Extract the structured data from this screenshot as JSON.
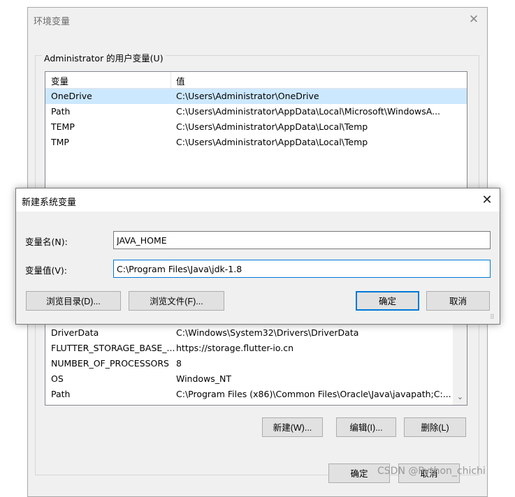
{
  "env_window": {
    "title": "环境变量",
    "user_group_label": "Administrator 的用户变量(U)",
    "user_list": {
      "col_name": "变量",
      "col_value": "值",
      "rows": [
        {
          "name": "OneDrive",
          "value": "C:\\Users\\Administrator\\OneDrive"
        },
        {
          "name": "Path",
          "value": "C:\\Users\\Administrator\\AppData\\Local\\Microsoft\\WindowsA..."
        },
        {
          "name": "TEMP",
          "value": "C:\\Users\\Administrator\\AppData\\Local\\Temp"
        },
        {
          "name": "TMP",
          "value": "C:\\Users\\Administrator\\AppData\\Local\\Temp"
        }
      ]
    },
    "sys_list": {
      "rows": [
        {
          "name": "DriverData",
          "value": "C:\\Windows\\System32\\Drivers\\DriverData"
        },
        {
          "name": "FLUTTER_STORAGE_BASE_...",
          "value": "https://storage.flutter-io.cn"
        },
        {
          "name": "NUMBER_OF_PROCESSORS",
          "value": "8"
        },
        {
          "name": "OS",
          "value": "Windows_NT"
        },
        {
          "name": "Path",
          "value": "C:\\Program Files (x86)\\Common Files\\Oracle\\Java\\javapath;C:..."
        }
      ]
    },
    "buttons": {
      "new": "新建(W)...",
      "edit": "编辑(I)...",
      "delete": "删除(L)",
      "ok": "确定",
      "cancel": "取消"
    }
  },
  "dialog": {
    "title": "新建系统变量",
    "name_label": "变量名(N):",
    "name_value": "JAVA_HOME",
    "value_label": "变量值(V):",
    "value_value": "C:\\Program Files\\Java\\jdk-1.8",
    "buttons": {
      "browse_dir": "浏览目录(D)...",
      "browse_file": "浏览文件(F)...",
      "ok": "确定",
      "cancel": "取消"
    }
  },
  "watermark": "CSDN @Python_chichi"
}
